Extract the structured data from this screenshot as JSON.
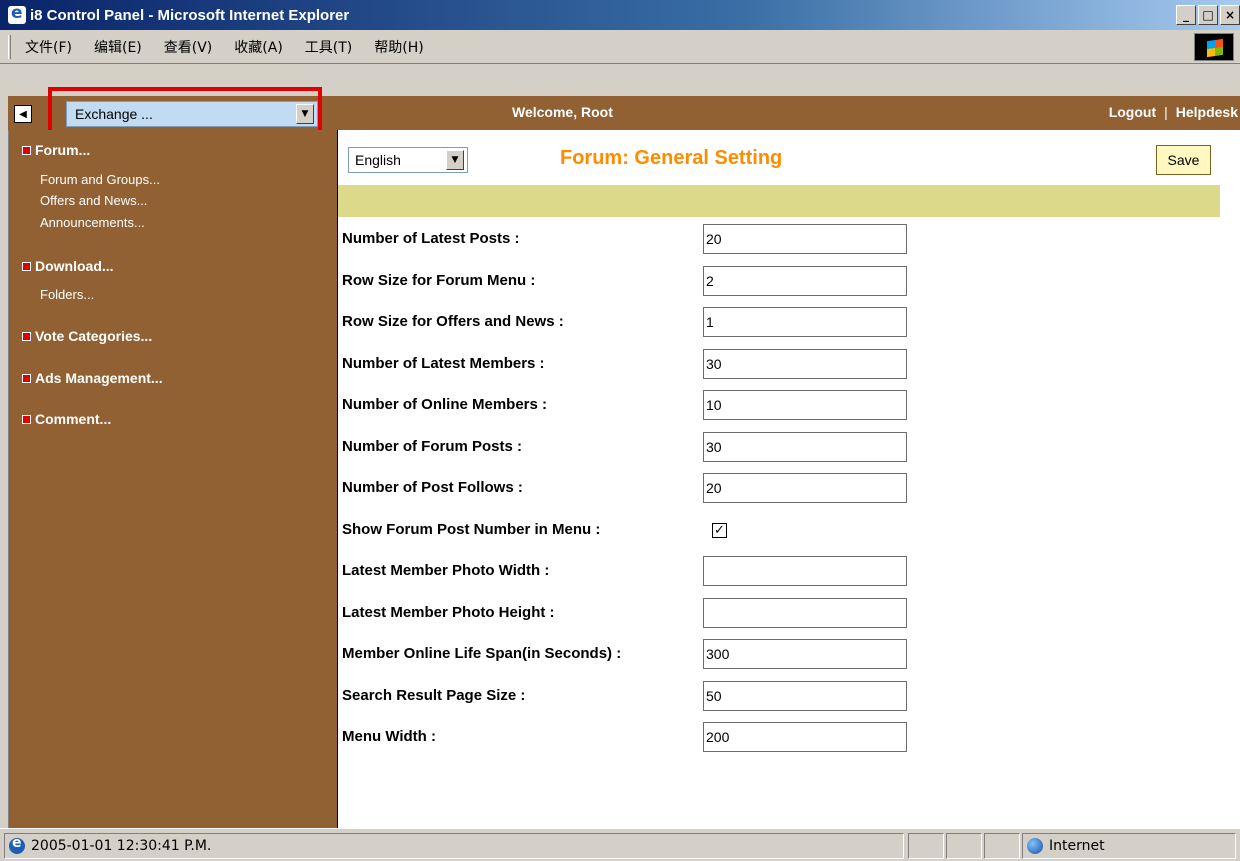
{
  "window": {
    "title": "i8 Control Panel - Microsoft Internet Explorer",
    "buttons": [
      "_",
      "□",
      "×"
    ]
  },
  "menubar": {
    "items": [
      "文件(F)",
      "编辑(E)",
      "查看(V)",
      "收藏(A)",
      "工具(T)",
      "帮助(H)"
    ]
  },
  "topbar": {
    "collapse_symbol": "◀",
    "site_select_value": "Exchange ...",
    "welcome": "Welcome, Root",
    "logout": "Logout",
    "separator": "|",
    "helpdesk": "Helpdesk"
  },
  "sidebar": {
    "sections": [
      {
        "label": "Forum...",
        "links": [
          "Forum and Groups...",
          "Offers and News...",
          "Announcements..."
        ]
      },
      {
        "label": "Download...",
        "links": [
          "Folders..."
        ]
      },
      {
        "label": "Vote Categories...",
        "links": []
      },
      {
        "label": "Ads Management...",
        "links": []
      },
      {
        "label": "Comment...",
        "links": []
      }
    ]
  },
  "content": {
    "language_value": "English",
    "title": "Forum: General Setting",
    "save_label": "Save",
    "fields": [
      {
        "label": "Number of Latest Posts :",
        "value": "20"
      },
      {
        "label": "Row Size for Forum Menu :",
        "value": "2"
      },
      {
        "label": "Row Size for Offers and News :",
        "value": "1"
      },
      {
        "label": "Number of Latest Members :",
        "value": "30"
      },
      {
        "label": "Number of Online Members :",
        "value": "10"
      },
      {
        "label": "Number of Forum Posts :",
        "value": "30"
      },
      {
        "label": "Number of Post Follows :",
        "value": "20"
      },
      {
        "label": "Show Forum Post Number in Menu :",
        "checked": true
      },
      {
        "label": "Latest Member Photo Width :",
        "value": ""
      },
      {
        "label": "Latest Member Photo Height :",
        "value": ""
      },
      {
        "label": "Member Online Life Span(in Seconds) :",
        "value": "300"
      },
      {
        "label": "Search Result Page Size :",
        "value": "50"
      },
      {
        "label": "Menu Width :",
        "value": "200"
      }
    ]
  },
  "statusbar": {
    "status_text": "2005-01-01 12:30:41 P.M.",
    "zone": "Internet"
  },
  "colors": {
    "brown": "#916134",
    "highlight_red": "#e00000",
    "title_orange": "#ff8c00",
    "band": "#dcd98a"
  }
}
